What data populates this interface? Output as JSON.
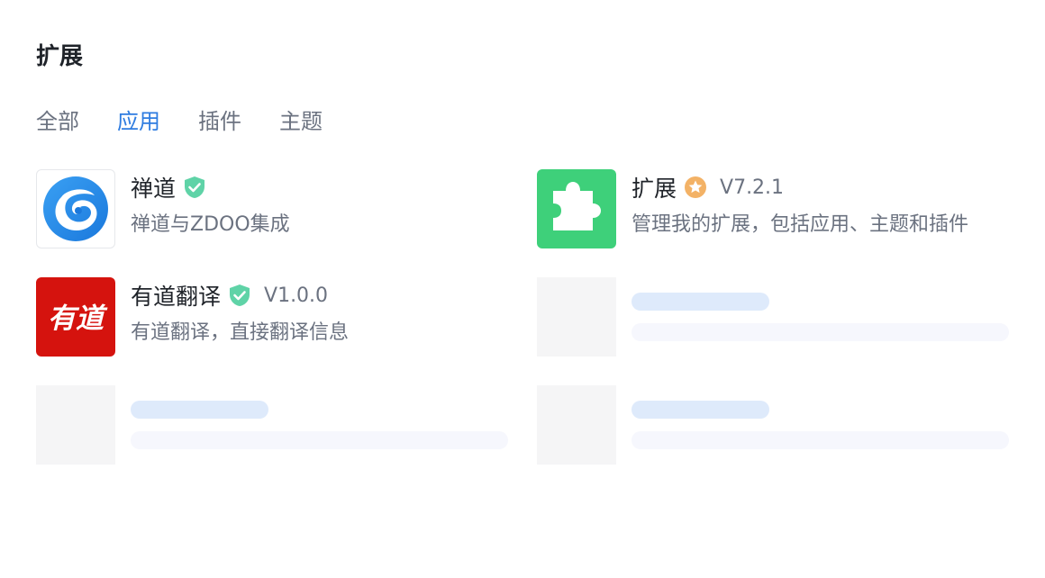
{
  "page": {
    "title": "扩展"
  },
  "tabs": [
    {
      "label": "全部",
      "active": false
    },
    {
      "label": "应用",
      "active": true
    },
    {
      "label": "插件",
      "active": false
    },
    {
      "label": "主题",
      "active": false
    }
  ],
  "extensions": [
    {
      "name": "禅道",
      "badge": "verified-shield-icon",
      "version": "",
      "description": "禅道与ZDOO集成",
      "icon": "zentao-logo-icon"
    },
    {
      "name": "扩展",
      "badge": "official-star-icon",
      "version": "V7.2.1",
      "description": "管理我的扩展，包括应用、主题和插件",
      "icon": "puzzle-piece-icon"
    },
    {
      "name": "有道翻译",
      "badge": "verified-shield-icon",
      "version": "V1.0.0",
      "description": "有道翻译，直接翻译信息",
      "icon": "youdao-logo-icon",
      "icon_text": "有道"
    }
  ],
  "colors": {
    "accent": "#2e7ce0",
    "verified": "#5fd3a7",
    "official": "#f3b266",
    "ext_icon_bg": "#3ed07a",
    "youdao_icon_bg": "#d5130e",
    "skeleton_title": "#deeafb",
    "skeleton_text": "#f6f7fd"
  }
}
